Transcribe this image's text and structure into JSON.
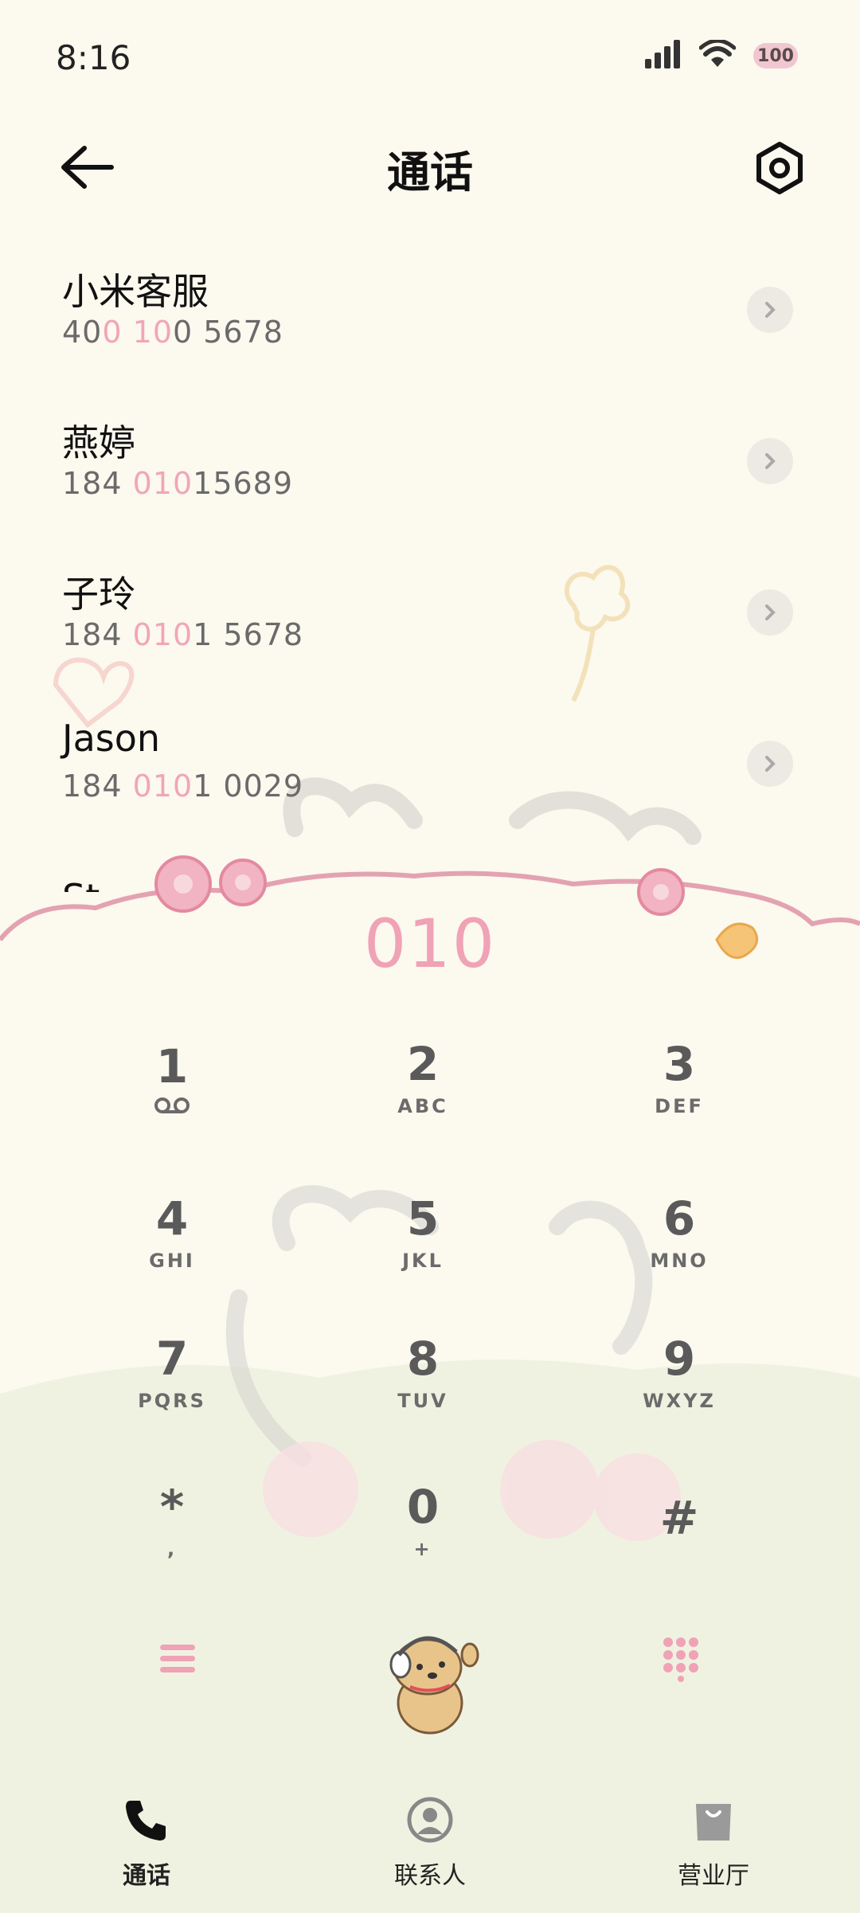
{
  "status_bar": {
    "time": "8:16",
    "battery": "100"
  },
  "header": {
    "title": "通话"
  },
  "contacts": [
    {
      "name": "小米客服",
      "number_parts": [
        "40",
        "0",
        " ",
        "10",
        "0 5678"
      ]
    },
    {
      "name": "燕婷",
      "number_parts": [
        "184 ",
        "010",
        "15689"
      ]
    },
    {
      "name": "子玲",
      "number_parts": [
        "184 ",
        "010",
        "1 5678"
      ]
    },
    {
      "name": "Jason",
      "number_parts": [
        "184 ",
        "010",
        "1 0029"
      ]
    },
    {
      "name": "St",
      "number_parts": []
    }
  ],
  "dialer": {
    "typed": "010",
    "keys": [
      {
        "digit": "1",
        "letters": ""
      },
      {
        "digit": "2",
        "letters": "ABC"
      },
      {
        "digit": "3",
        "letters": "DEF"
      },
      {
        "digit": "4",
        "letters": "GHI"
      },
      {
        "digit": "5",
        "letters": "JKL"
      },
      {
        "digit": "6",
        "letters": "MNO"
      },
      {
        "digit": "7",
        "letters": "PQRS"
      },
      {
        "digit": "8",
        "letters": "TUV"
      },
      {
        "digit": "9",
        "letters": "WXYZ"
      },
      {
        "digit": "*",
        "letters": ","
      },
      {
        "digit": "0",
        "letters": "+"
      },
      {
        "digit": "#",
        "letters": ""
      }
    ]
  },
  "bottom_nav": {
    "calls": "通话",
    "contacts": "联系人",
    "store": "营业厅"
  },
  "colors": {
    "background": "#fcf9ef",
    "accent_pink": "#f0a2b6",
    "key_text": "#5a5a5a"
  }
}
